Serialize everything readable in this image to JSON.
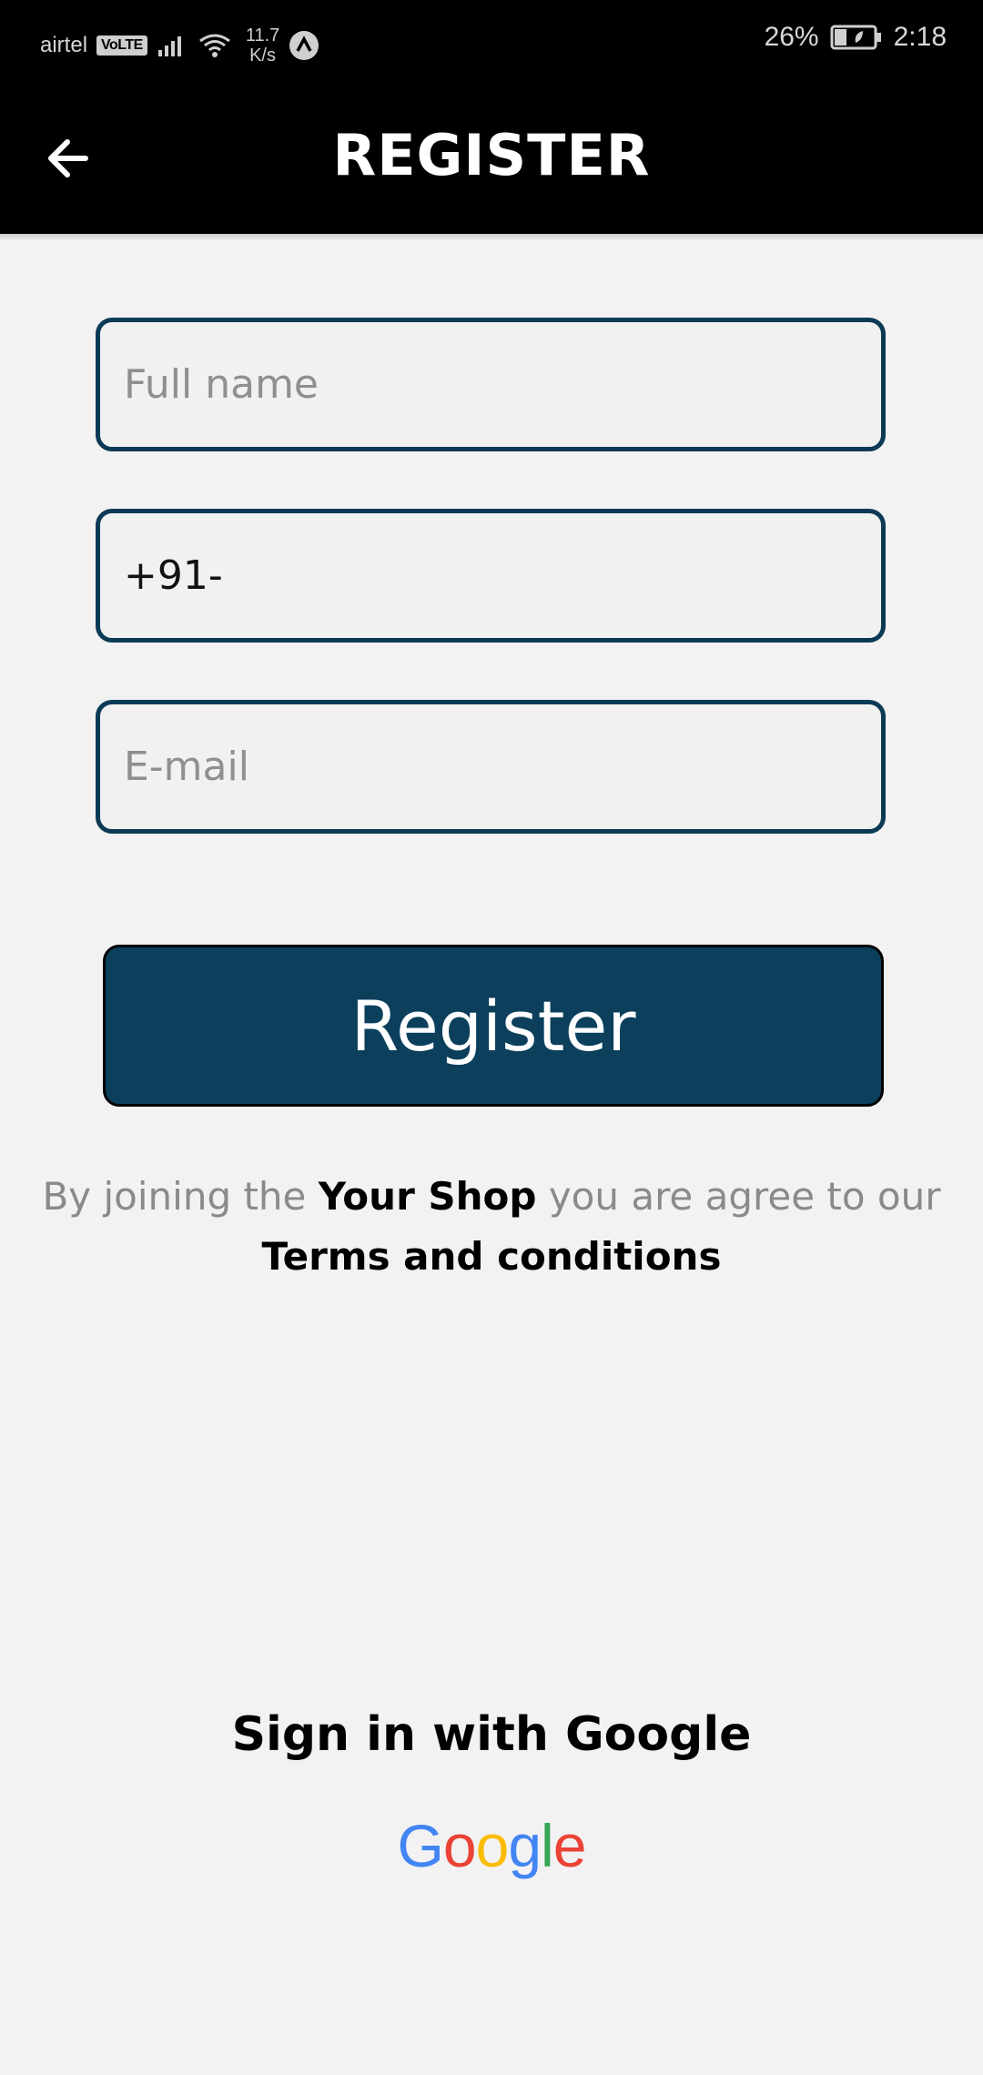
{
  "status_bar": {
    "carrier": "airtel",
    "volte": "VoLTE",
    "speed_value": "11.7",
    "speed_unit": "K/s",
    "battery": "26%",
    "time": "2:18"
  },
  "app_bar": {
    "title": "REGISTER",
    "back_icon": "arrow-left-icon"
  },
  "form": {
    "full_name": {
      "value": "",
      "placeholder": "Full name"
    },
    "phone": {
      "value": "+91-",
      "placeholder": ""
    },
    "email": {
      "value": "",
      "placeholder": "E-mail"
    }
  },
  "register_button": {
    "label": "Register"
  },
  "terms": {
    "prefix": "By joining the",
    "shop_name": "Your Shop",
    "middle": "you are agree to our",
    "link": "Terms and conditions"
  },
  "google": {
    "title": "Sign in with Google",
    "logo_letters": [
      "G",
      "o",
      "o",
      "g",
      "l",
      "e"
    ],
    "logo_colors": [
      "#4285F4",
      "#EA4335",
      "#FBBC05",
      "#4285F4",
      "#34A853",
      "#EA4335"
    ]
  },
  "colors": {
    "accent": "#0b3f5c",
    "field_border": "#0b3a55",
    "background": "#f2f2f2",
    "app_bar": "#000000"
  }
}
